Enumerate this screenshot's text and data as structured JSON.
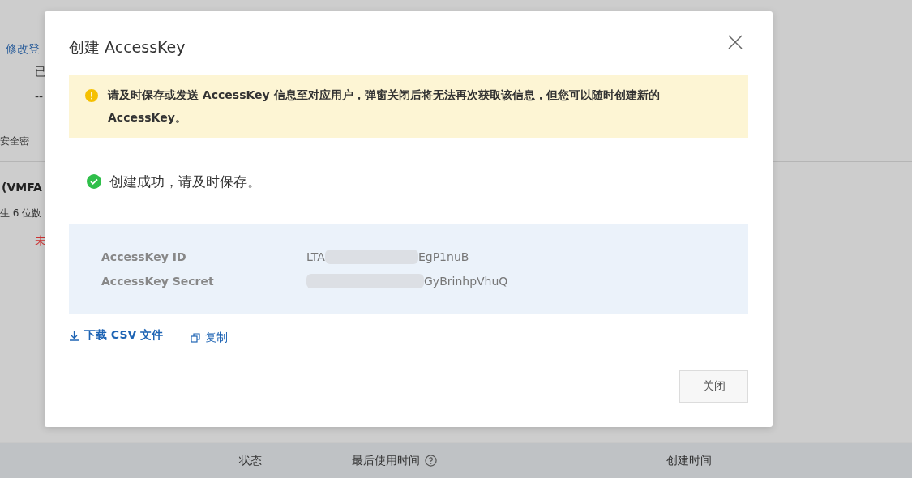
{
  "background": {
    "fragments": [
      {
        "kind": "link",
        "text": "修改登"
      },
      {
        "kind": "text",
        "text": "已"
      },
      {
        "kind": "text",
        "text": "--"
      },
      {
        "kind": "divider"
      },
      {
        "kind": "edge",
        "text": "安全密"
      },
      {
        "kind": "divider"
      },
      {
        "kind": "bold",
        "text": "(VMFA"
      },
      {
        "kind": "edge",
        "text": "生 6 位数"
      },
      {
        "kind": "danger",
        "text": "未"
      }
    ],
    "table": {
      "columns": [
        {
          "kind": "plain",
          "label": "状态"
        },
        {
          "kind": "help",
          "label": "最后使用时间"
        },
        {
          "kind": "plain",
          "label": "创建时间"
        }
      ]
    }
  },
  "dialog": {
    "title": "创建 AccessKey",
    "alert": {
      "text": "请及时保存或发送 AccessKey 信息至对应用户，弹窗关闭后将无法再次获取该信息，但您可以随时创建新的 AccessKey。"
    },
    "success": "创建成功，请及时保存。",
    "keys": [
      {
        "label": "AccessKey ID",
        "start": "LTA",
        "end": "EgP1nuB"
      },
      {
        "label": "AccessKey Secret",
        "end": "GyBrinhpVhuQ"
      }
    ],
    "actions": [
      {
        "kind": "download",
        "label": "下载 CSV 文件"
      },
      {
        "kind": "copy",
        "label": "复制"
      }
    ],
    "footer_button": "关闭"
  }
}
